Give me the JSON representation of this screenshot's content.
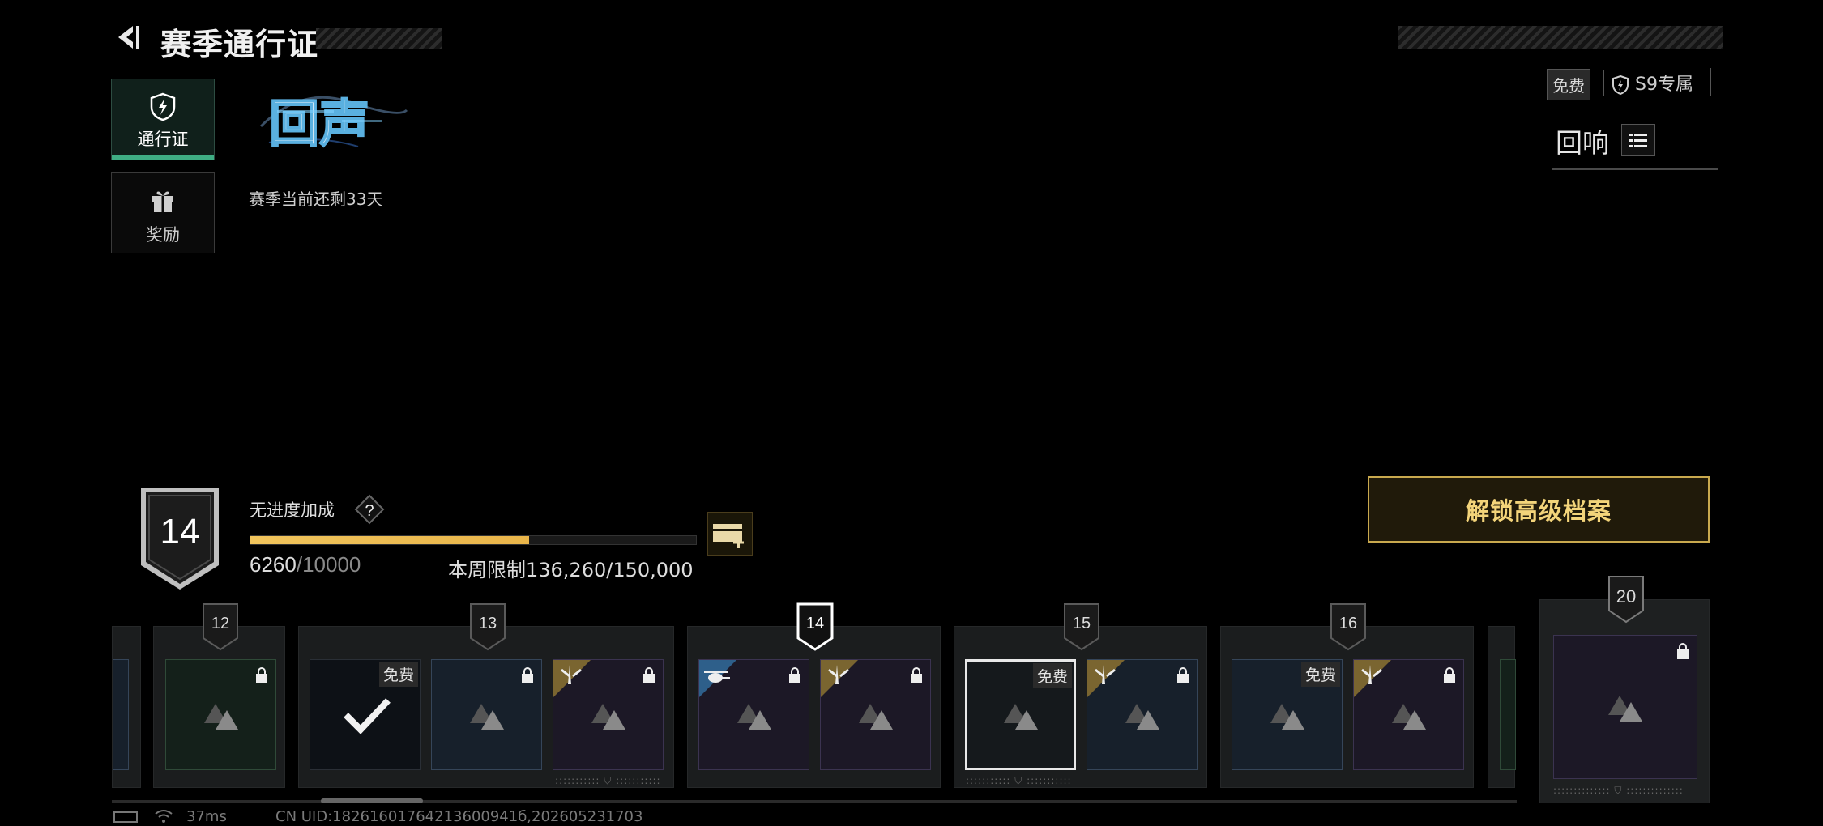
{
  "header": {
    "title": "赛季通行证"
  },
  "nav": {
    "pass_label": "通行证",
    "reward_label": "奖励"
  },
  "season": {
    "logo_text": "回声",
    "remaining": "赛季当前还剩33天"
  },
  "top_right": {
    "free_label": "免费",
    "s9_label": "S9专属",
    "echo_label": "回响"
  },
  "level": {
    "current": "14",
    "no_bonus_label": "无进度加成",
    "help_symbol": "?",
    "xp_current": "6260",
    "xp_max": "/10000",
    "xp_progress": 0.626,
    "weekly_limit": "本周限制136,260/150,000"
  },
  "unlock_button": "解锁高级档案",
  "tiers": [
    {
      "level": "12"
    },
    {
      "level": "13",
      "free_tag": "免费"
    },
    {
      "level": "14"
    },
    {
      "level": "15",
      "free_tag": "免费"
    },
    {
      "level": "16",
      "free_tag": "免费"
    },
    {
      "level": "20"
    }
  ],
  "status": {
    "ping": "37ms",
    "uid": "CN UID:18261601764213600941б,202605231703"
  }
}
